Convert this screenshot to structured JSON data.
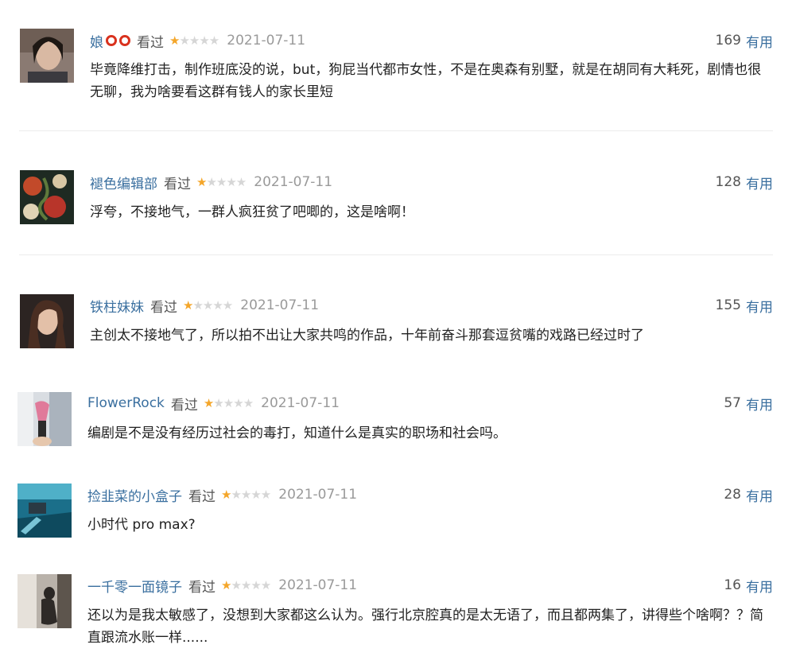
{
  "comments": [
    {
      "author": "娘",
      "status": "看过",
      "rating": 1,
      "max_rating": 5,
      "date": "2021-07-11",
      "votes": "169",
      "useful_label": "有用",
      "text": "毕竟降维打击，制作班底没的说，but，狗屁当代都市女性，不是在奥森有别墅，就是在胡同有大耗死，剧情也很无聊，我为啥要看这群有钱人的家长里短"
    },
    {
      "author": "褪色编辑部",
      "status": "看过",
      "rating": 1,
      "max_rating": 5,
      "date": "2021-07-11",
      "votes": "128",
      "useful_label": "有用",
      "text": "浮夸，不接地气，一群人疯狂贫了吧唧的，这是啥啊！"
    },
    {
      "author": "铁柱妹妹",
      "status": "看过",
      "rating": 1,
      "max_rating": 5,
      "date": "2021-07-11",
      "votes": "155",
      "useful_label": "有用",
      "text": "主创太不接地气了，所以拍不出让大家共鸣的作品，十年前奋斗那套逗贫嘴的戏路已经过时了"
    },
    {
      "author": "FlowerRock",
      "status": "看过",
      "rating": 1,
      "max_rating": 5,
      "date": "2021-07-11",
      "votes": "57",
      "useful_label": "有用",
      "text": "编剧是不是没有经历过社会的毒打，知道什么是真实的职场和社会吗。"
    },
    {
      "author": "捡韭菜的小盒子",
      "status": "看过",
      "rating": 1,
      "max_rating": 5,
      "date": "2021-07-11",
      "votes": "28",
      "useful_label": "有用",
      "text": "小时代 pro max?"
    },
    {
      "author": "一千零一面镜子",
      "status": "看过",
      "rating": 1,
      "max_rating": 5,
      "date": "2021-07-11",
      "votes": "16",
      "useful_label": "有用",
      "text": "还以为是我太敏感了，没想到大家都这么认为。强行北京腔真的是太无语了，而且都两集了，讲得些个啥啊？？简直跟流水账一样......"
    }
  ],
  "icons": {
    "author_badge": "double-red-circle-icon",
    "star_filled": "star-filled-icon",
    "star_empty": "star-empty-icon"
  },
  "colors": {
    "link": "#3a6f9f",
    "star": "#f4a62a",
    "date": "#9a9a9a",
    "badge": "#d9321e"
  }
}
